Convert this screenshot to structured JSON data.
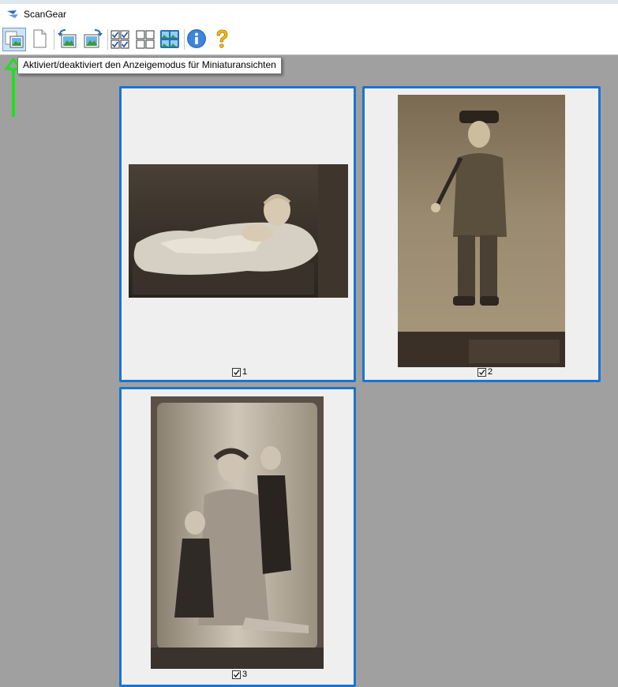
{
  "window": {
    "title": "ScanGear"
  },
  "toolbar": {
    "buttons": [
      {
        "name": "thumbnail-view-toggle-button",
        "icon": "thumbnail-view-icon",
        "pressed": true
      },
      {
        "name": "new-page-button",
        "icon": "page-icon"
      },
      {
        "name": "rotate-left-button",
        "icon": "rotate-left-icon"
      },
      {
        "name": "rotate-right-button",
        "icon": "rotate-right-icon"
      },
      {
        "name": "select-all-button",
        "icon": "checkbox-all-icon"
      },
      {
        "name": "deselect-all-button",
        "icon": "checkbox-none-icon"
      },
      {
        "name": "multi-view-button",
        "icon": "multi-image-icon"
      },
      {
        "name": "info-button",
        "icon": "info-icon"
      },
      {
        "name": "help-button",
        "icon": "help-icon"
      }
    ]
  },
  "tooltip": {
    "text": "Aktiviert/deaktiviert den Anzeigemodus für Miniaturansichten"
  },
  "annotation": {
    "arrow_color": "#22dd22"
  },
  "thumbnails": [
    {
      "label": "1",
      "checked": true,
      "subject": "baby-on-fur-photo"
    },
    {
      "label": "2",
      "checked": true,
      "subject": "boy-in-uniform-photo"
    },
    {
      "label": "3",
      "checked": true,
      "subject": "family-portrait-photo"
    }
  ],
  "colors": {
    "selection_border": "#1a74d0",
    "canvas_background": "#a0a0a0"
  }
}
